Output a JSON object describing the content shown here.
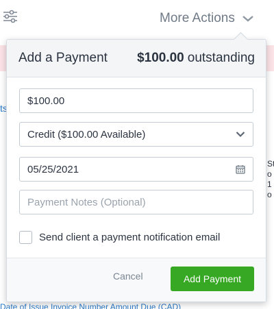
{
  "background": {
    "more_actions_label": "More Actions",
    "left_fragment": "ts",
    "right_fragment": [
      "St",
      "o",
      "1",
      "o"
    ],
    "bottom_fragment": "Date of Issue        Invoice Number          Amount Due (CAD)"
  },
  "payment": {
    "title": "Add a Payment",
    "outstanding_amount": "$100.00",
    "outstanding_label": "outstanding",
    "amount_value": "$100.00",
    "method_selected": "Credit ($100.00 Available)",
    "date_value": "05/25/2021",
    "notes_placeholder": "Payment Notes (Optional)",
    "notify_label": "Send client a payment notification email",
    "notify_checked": false,
    "cancel_label": "Cancel",
    "submit_label": "Add Payment"
  },
  "colors": {
    "accent_green": "#37a824",
    "banner_pink": "#fbe3e6",
    "link_blue": "#2a79c8"
  },
  "icons": {
    "filter": "sliders-icon",
    "more_actions": "chevron-down-icon",
    "select": "chevron-down-icon",
    "date": "calendar-icon"
  }
}
